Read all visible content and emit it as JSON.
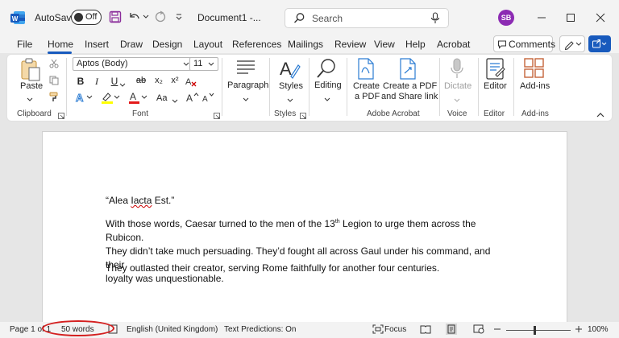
{
  "titlebar": {
    "autosave_label": "AutoSave",
    "autosave_state": "Off",
    "doc_title": "Document1  -...",
    "search_placeholder": "Search",
    "user_initials": "SB"
  },
  "menu": {
    "tabs": [
      "File",
      "Home",
      "Insert",
      "Draw",
      "Design",
      "Layout",
      "References",
      "Mailings",
      "Review",
      "View",
      "Help",
      "Acrobat"
    ],
    "active": "Home",
    "comments_label": "Comments"
  },
  "ribbon": {
    "clipboard": {
      "paste": "Paste",
      "group": "Clipboard"
    },
    "font": {
      "name": "Aptos (Body)",
      "size": "11",
      "group": "Font",
      "bold": "B",
      "italic": "I",
      "underline": "U",
      "strike": "ab",
      "sub": "x₂",
      "sup": "x²",
      "change_case": "Aa",
      "grow": "A^",
      "shrink": "Aˇ"
    },
    "paragraph": {
      "label": "Paragraph"
    },
    "styles": {
      "label": "Styles",
      "group": "Styles"
    },
    "editing": {
      "label": "Editing"
    },
    "acrobat": {
      "create_pdf_1": "Create",
      "create_pdf_2": "a PDF",
      "share_1": "Create a PDF",
      "share_2": "and Share link",
      "group": "Adobe Acrobat"
    },
    "voice": {
      "dictate": "Dictate",
      "group": "Voice"
    },
    "editor": {
      "label": "Editor",
      "group": "Editor"
    },
    "addins": {
      "label": "Add-ins",
      "group": "Add-ins"
    }
  },
  "document": {
    "p1_pre": "“Alea ",
    "p1_squig": "Iacta",
    "p1_post": " Est.”",
    "p2_line1_a": "With those words, Caesar turned to the men of the 13",
    "p2_line1_sup": "th",
    "p2_line1_b": " Legion to urge them across the Rubicon.",
    "p2_line2": "They didn’t take much persuading. They’d fought all across Gaul under his command, and their",
    "p2_line3": "loyalty was unquestionable.",
    "p3": "They outlasted their creator, serving Rome faithfully for another four centuries."
  },
  "status": {
    "page": "Page 1 of 1",
    "words": "50 words",
    "language": "English (United Kingdom)",
    "predictions": "Text Predictions: On",
    "focus": "Focus",
    "zoom": "100%"
  },
  "colors": {
    "accent": "#185abd",
    "word_blue": "#185abd",
    "avatar": "#8c2bb3",
    "highlight": "#d41f1f"
  }
}
